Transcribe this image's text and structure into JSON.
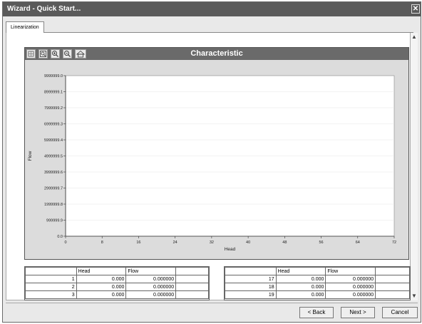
{
  "window": {
    "title": "Wizard - Quick Start...",
    "close_glyph": "✕"
  },
  "tabs": [
    {
      "label": "Linearization"
    }
  ],
  "toolbar": {
    "icons": [
      "grid-icon",
      "zoom-box-icon",
      "zoom-in-icon",
      "zoom-out-icon",
      "home-icon"
    ]
  },
  "chart_data": {
    "type": "line",
    "title": "Characteristic",
    "xlabel": "Head",
    "ylabel": "Flow",
    "x_ticks": [
      "0",
      "8",
      "16",
      "24",
      "32",
      "40",
      "48",
      "56",
      "64",
      "72"
    ],
    "y_ticks": [
      "0.0",
      "999999.9",
      "1999999.8",
      "2999999.7",
      "3999999.6",
      "4999999.5",
      "5999999.4",
      "6999999.3",
      "7999999.2",
      "8999999.1",
      "9999999.0"
    ],
    "xlim": [
      0,
      72
    ],
    "ylim": [
      0,
      9999999.0
    ],
    "grid": true,
    "series": []
  },
  "tables": {
    "left": {
      "headers": [
        "",
        "Head",
        "Flow"
      ],
      "rows": [
        {
          "n": "1",
          "head": "0.000",
          "flow": "0.000000"
        },
        {
          "n": "2",
          "head": "0.000",
          "flow": "0.000000"
        },
        {
          "n": "3",
          "head": "0.000",
          "flow": "0.000000"
        }
      ]
    },
    "right": {
      "headers": [
        "",
        "Head",
        "Flow"
      ],
      "rows": [
        {
          "n": "17",
          "head": "0.000",
          "flow": "0.000000"
        },
        {
          "n": "18",
          "head": "0.000",
          "flow": "0.000000"
        },
        {
          "n": "19",
          "head": "0.000",
          "flow": "0.000000"
        }
      ]
    }
  },
  "buttons": {
    "back": "< Back",
    "next": "Next >",
    "cancel": "Cancel"
  },
  "scrollbar": {
    "up": "▲",
    "down": "▼"
  }
}
